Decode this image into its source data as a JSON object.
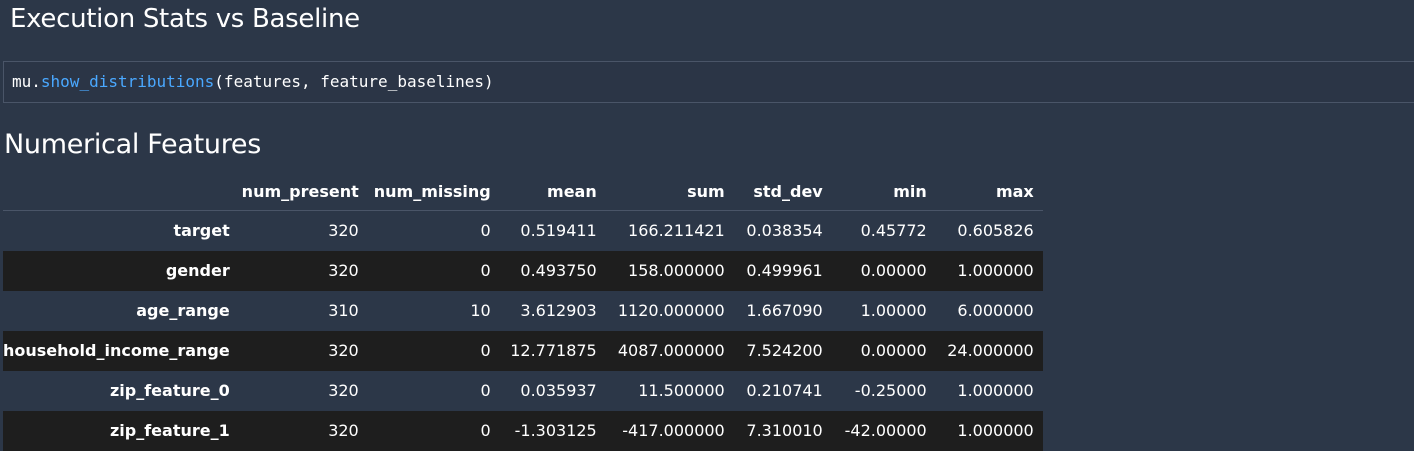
{
  "page": {
    "title": "Execution Stats vs Baseline",
    "code": {
      "object": "mu",
      "dot": ".",
      "function": "show_distributions",
      "args": "(features, feature_baselines)"
    },
    "section_title": "Numerical Features"
  },
  "table": {
    "columns": [
      "",
      "num_present",
      "num_missing",
      "mean",
      "sum",
      "std_dev",
      "min",
      "max"
    ],
    "rows": [
      {
        "name": "target",
        "num_present": "320",
        "num_missing": "0",
        "mean": "0.519411",
        "sum": "166.211421",
        "std_dev": "0.038354",
        "min": "0.45772",
        "max": "0.605826"
      },
      {
        "name": "gender",
        "num_present": "320",
        "num_missing": "0",
        "mean": "0.493750",
        "sum": "158.000000",
        "std_dev": "0.499961",
        "min": "0.00000",
        "max": "1.000000"
      },
      {
        "name": "age_range",
        "num_present": "310",
        "num_missing": "10",
        "mean": "3.612903",
        "sum": "1120.000000",
        "std_dev": "1.667090",
        "min": "1.00000",
        "max": "6.000000"
      },
      {
        "name": "household_income_range",
        "num_present": "320",
        "num_missing": "0",
        "mean": "12.771875",
        "sum": "4087.000000",
        "std_dev": "7.524200",
        "min": "0.00000",
        "max": "24.000000"
      },
      {
        "name": "zip_feature_0",
        "num_present": "320",
        "num_missing": "0",
        "mean": "0.035937",
        "sum": "11.500000",
        "std_dev": "0.210741",
        "min": "-0.25000",
        "max": "1.000000"
      },
      {
        "name": "zip_feature_1",
        "num_present": "320",
        "num_missing": "0",
        "mean": "-1.303125",
        "sum": "-417.000000",
        "std_dev": "7.310010",
        "min": "-42.00000",
        "max": "1.000000"
      }
    ]
  },
  "colors": {
    "background": "#2c3748",
    "function_name": "#4aa8ff",
    "stripe_row": "#1e1e1e",
    "text": "#ffffff"
  }
}
